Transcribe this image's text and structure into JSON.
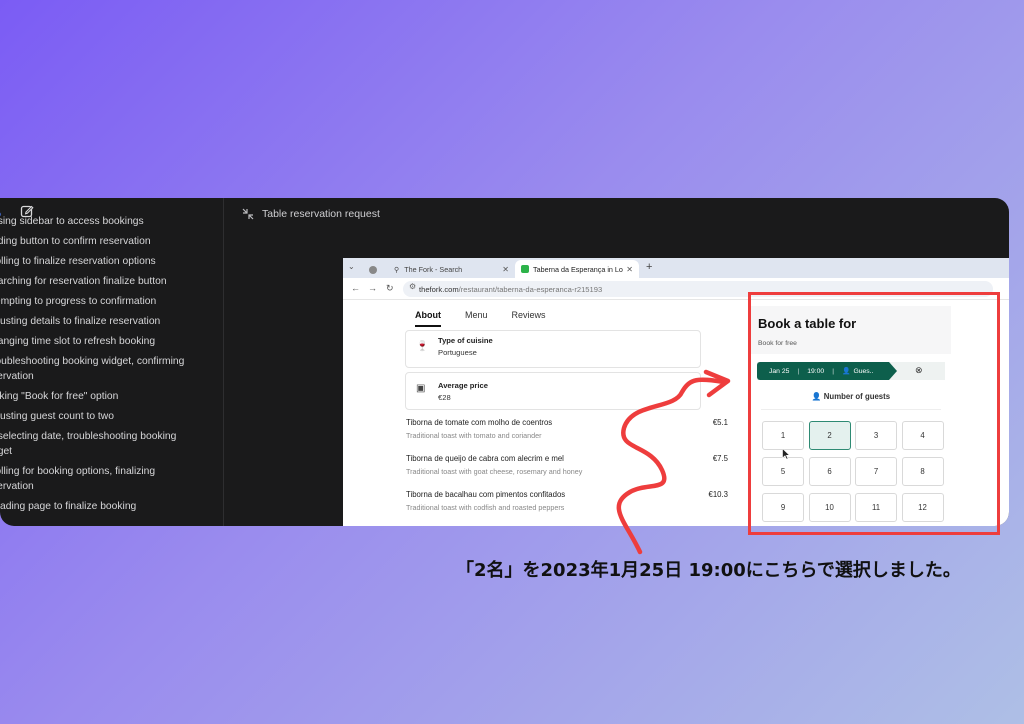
{
  "sidebar": {
    "steps": [
      "using sidebar to access bookings",
      "nding button to confirm reservation",
      "rolling to finalize reservation options",
      "earching for reservation finalize button",
      "tempting to progress to confirmation",
      "djusting details to finalize reservation",
      "hanging time slot to refresh booking",
      "roubleshooting booking widget, confirming",
      "servation",
      "icking \"Book for free\" option",
      "djusting guest count to two",
      "eselecting date, troubleshooting booking",
      "dget",
      "rolling for booking options, finalizing",
      "servation",
      "loading page to finalize booking"
    ]
  },
  "header": {
    "title": "Table reservation request"
  },
  "browser": {
    "tab1_label": "The Fork - Search",
    "tab2_label": "Taberna da Esperança in Lo",
    "url_host": "thefork.com",
    "url_path": "/restaurant/taberna-da-esperanca-r215193"
  },
  "restaurant": {
    "tabs": [
      "About",
      "Menu",
      "Reviews"
    ],
    "cuisine_label": "Type of cuisine",
    "cuisine_value": "Portuguese",
    "price_label": "Average price",
    "price_value": "€28",
    "dishes": [
      {
        "name": "Tiborna de tomate com molho de coentros",
        "desc": "Traditional toast with tomato and coriander",
        "price": "€5.1"
      },
      {
        "name": "Tiborna de queijo de cabra com alecrim e mel",
        "desc": "Traditional toast with goat cheese, rosemary and honey",
        "price": "€7.5"
      },
      {
        "name": "Tiborna de bacalhau com pimentos confitados",
        "desc": "Traditional toast with codfish and roasted peppers",
        "price": "€10.3"
      }
    ]
  },
  "booking": {
    "title": "Book a table for",
    "subtitle": "Book for free",
    "date": "Jan 25",
    "time": "19:00",
    "guests_short": "Gues..",
    "guests_heading": "Number of guests",
    "options": [
      "1",
      "2",
      "3",
      "4",
      "5",
      "6",
      "7",
      "8",
      "9",
      "10",
      "11",
      "12"
    ],
    "selected": "2"
  },
  "annotation": {
    "caption": "「2名」を2023年1月25日 19:00にこちらで選択しました。",
    "color": "#ee3d3d"
  }
}
